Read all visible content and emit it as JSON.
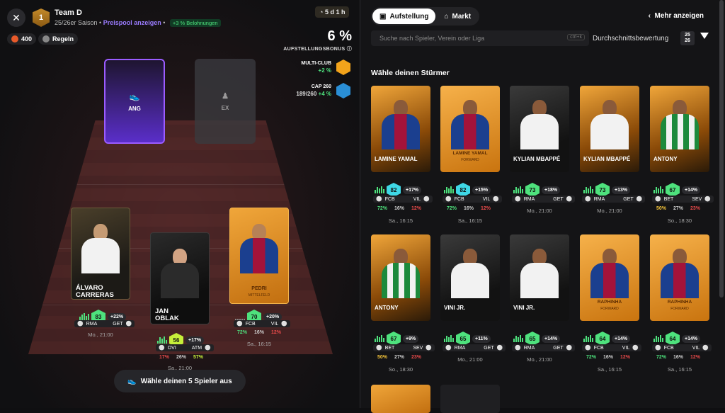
{
  "header": {
    "close": "✕",
    "team_badge": "1",
    "team_name": "Team D",
    "season": "25/26er Saison",
    "pool_link": "Preispool anzeigen",
    "reward_badge": "+3 % Belohnungen",
    "timer": "5 d 1 h",
    "coins": "400",
    "rules": "Regeln"
  },
  "bonus": {
    "value": "6 %",
    "label": "AUFSTELLUNGSBONUS",
    "multi_label": "MULTI-CLUB",
    "multi_val": "+2 %",
    "cap_label": "CAP 260",
    "cap_val": "189/260",
    "cap_pct": "+4 %"
  },
  "slots": {
    "ang": "ANG",
    "ex": "EX"
  },
  "lineup": [
    {
      "first": "ÁLVARO",
      "last": "CARRERAS",
      "score": "83",
      "bonus": "+22%",
      "home": "RMA",
      "away": "GET",
      "date": "Mo., 21:00",
      "tier": "silver"
    },
    {
      "first": "JAN",
      "last": "OBLAK",
      "score": "56",
      "bonus": "+17%",
      "home": "OVI",
      "away": "ATM",
      "date": "Sa., 21:00",
      "tier": "black",
      "p1": "17%",
      "p2": "26%",
      "p3": "57%"
    },
    {
      "first": "",
      "last": "PEDRI",
      "sub": "MITTELFELD",
      "score": "70",
      "bonus": "+20%",
      "home": "FCB",
      "away": "VIL",
      "date": "Sa., 16:15",
      "tier": "gold",
      "p1": "72%",
      "p2": "16%",
      "p3": "12%"
    }
  ],
  "choose_btn": "Wähle deinen 5 Spieler aus",
  "right": {
    "tab1": "Aufstellung",
    "tab2": "Markt",
    "more": "Mehr anzeigen",
    "search_placeholder": "Suche nach Spieler, Verein oder Liga",
    "kbd": "ctrl+k",
    "sort": "Durchschnittsbewertung",
    "season_pill_top": "25",
    "season_pill_bot": "26",
    "heading": "Wähle deinen Stürmer"
  },
  "cards": [
    {
      "name": "LAMINE YAMAL",
      "score": "82",
      "bonus": "+17%",
      "home": "FCB",
      "away": "VIL",
      "p": [
        "72%",
        "16%",
        "12%"
      ],
      "date": "Sa., 16:15",
      "tier": "holo",
      "kit": "barca"
    },
    {
      "name": "LAMINE YAMAL",
      "sub": "FORWARD",
      "score": "82",
      "bonus": "+15%",
      "home": "FCB",
      "away": "VIL",
      "p": [
        "72%",
        "16%",
        "12%"
      ],
      "date": "Sa., 16:15",
      "tier": "gold",
      "kit": "barca"
    },
    {
      "name": "KYLIAN MBAPPÉ",
      "score": "73",
      "bonus": "+18%",
      "home": "RMA",
      "away": "GET",
      "p": [],
      "date": "Mo., 21:00",
      "tier": "white",
      "kit": "madrid"
    },
    {
      "name": "KYLIAN MBAPPÉ",
      "score": "73",
      "bonus": "+13%",
      "home": "RMA",
      "away": "GET",
      "p": [],
      "date": "Mo., 21:00",
      "tier": "holo",
      "kit": "madrid"
    },
    {
      "name": "ANTONY",
      "score": "67",
      "bonus": "+14%",
      "home": "BET",
      "away": "SEV",
      "p": [
        "50%",
        "27%",
        "23%"
      ],
      "date": "So., 18:30",
      "tier": "holo",
      "kit": "betis"
    },
    {
      "name": "ANTONY",
      "score": "67",
      "bonus": "+9%",
      "home": "BET",
      "away": "SEV",
      "p": [
        "50%",
        "27%",
        "23%"
      ],
      "date": "So., 18:30",
      "tier": "holo",
      "kit": "betis"
    },
    {
      "name": "VINI JR.",
      "score": "65",
      "bonus": "+11%",
      "home": "RMA",
      "away": "GET",
      "p": [],
      "date": "Mo., 21:00",
      "tier": "white",
      "kit": "madrid"
    },
    {
      "name": "VINI JR.",
      "score": "65",
      "bonus": "+14%",
      "home": "RMA",
      "away": "GET",
      "p": [],
      "date": "Mo., 21:00",
      "tier": "white",
      "kit": "madrid"
    },
    {
      "name": "RAPHINHA",
      "sub": "FORWARD",
      "score": "64",
      "bonus": "+14%",
      "home": "FCB",
      "away": "VIL",
      "p": [
        "72%",
        "16%",
        "12%"
      ],
      "date": "Sa., 16:15",
      "tier": "gold",
      "kit": "barca"
    },
    {
      "name": "RAPHINHA",
      "sub": "FORWARD",
      "score": "64",
      "bonus": "+14%",
      "home": "FCB",
      "away": "VIL",
      "p": [
        "72%",
        "16%",
        "12%"
      ],
      "date": "Sa., 16:15",
      "tier": "gold",
      "kit": "barca"
    }
  ],
  "colors": {
    "accent": "#9b5cff",
    "green": "#4ee27d",
    "hex_cyan": "#3fd8e6",
    "hex_green": "#4ee27d"
  }
}
